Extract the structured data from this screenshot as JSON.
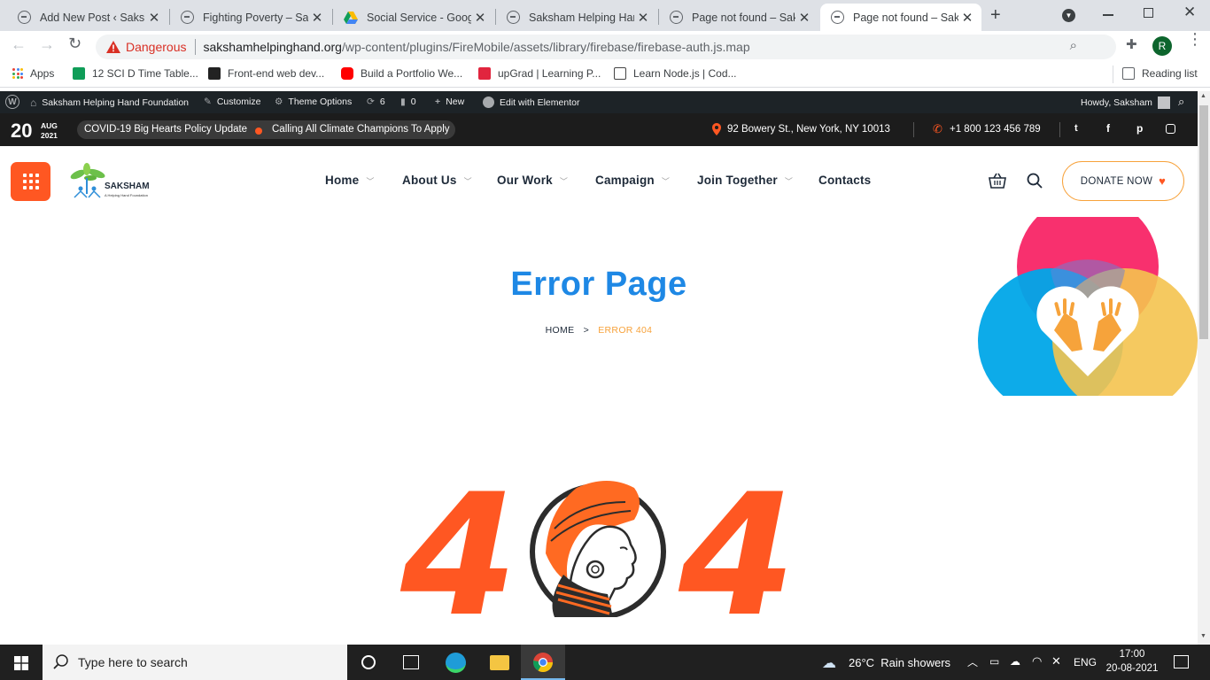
{
  "browser": {
    "tabs": [
      {
        "title": "Add New Post ‹ Saksham Helping Hand",
        "active": false
      },
      {
        "title": "Fighting Poverty – Saksham Helping",
        "active": false
      },
      {
        "title": "Social Service - Google Drive",
        "active": false
      },
      {
        "title": "Saksham Helping Hand Foundation",
        "active": false
      },
      {
        "title": "Page not found – Saksham Helping",
        "active": false
      },
      {
        "title": "Page not found – Saksham Helping",
        "active": true
      }
    ],
    "security_label": "Dangerous",
    "url_host": "sakshamhelpinghand.org",
    "url_path": "/wp-content/plugins/FireMobile/assets/library/firebase/firebase-auth.js.map",
    "profile_initial": "R",
    "bookmarks": [
      {
        "label": "Apps",
        "color": "#ea4335"
      },
      {
        "label": "12 SCI D Time Table...",
        "color": "#0f9d58"
      },
      {
        "label": "Front-end web dev...",
        "color": "#222222"
      },
      {
        "label": "Build a Portfolio We...",
        "color": "#ff0000"
      },
      {
        "label": "upGrad | Learning P...",
        "color": "#e1253e"
      },
      {
        "label": "Learn Node.js | Cod...",
        "color": "#444444"
      }
    ],
    "reading_list": "Reading list"
  },
  "adminbar": {
    "site_name": "Saksham Helping Hand Foundation",
    "customize": "Customize",
    "theme_options": "Theme Options",
    "updates": "6",
    "comments": "0",
    "new": "New",
    "elementor": "Edit with Elementor",
    "howdy": "Howdy, Saksham"
  },
  "topbar": {
    "day": "20",
    "month": "AUG",
    "year": "2021",
    "news": [
      "COVID-19 Big Hearts Policy Update",
      "Calling All Climate Champions To Apply"
    ],
    "address": "92 Bowery St., New York, NY 10013",
    "phone": "+1 800 123 456 789",
    "accent": "#ff5722"
  },
  "header": {
    "logo_name": "SAKSHAM",
    "logo_tagline": "A Helping Hand Foundation",
    "nav": [
      {
        "label": "Home",
        "dropdown": true
      },
      {
        "label": "About Us",
        "dropdown": true
      },
      {
        "label": "Our Work",
        "dropdown": true
      },
      {
        "label": "Campaign",
        "dropdown": true
      },
      {
        "label": "Join Together",
        "dropdown": true
      },
      {
        "label": "Contacts",
        "dropdown": false
      }
    ],
    "donate": "DONATE NOW"
  },
  "page": {
    "title": "Error Page",
    "breadcrumb_home": "HOME",
    "breadcrumb_sep": ">",
    "breadcrumb_current": "ERROR 404",
    "error_left": "4",
    "error_right": "4",
    "title_color": "#1e88e5",
    "highlight_color": "#f7a23b"
  },
  "taskbar": {
    "search_placeholder": "Type here to search",
    "weather": "26°C  Rain showers",
    "lang": "ENG",
    "time": "17:00",
    "date": "20-08-2021"
  }
}
